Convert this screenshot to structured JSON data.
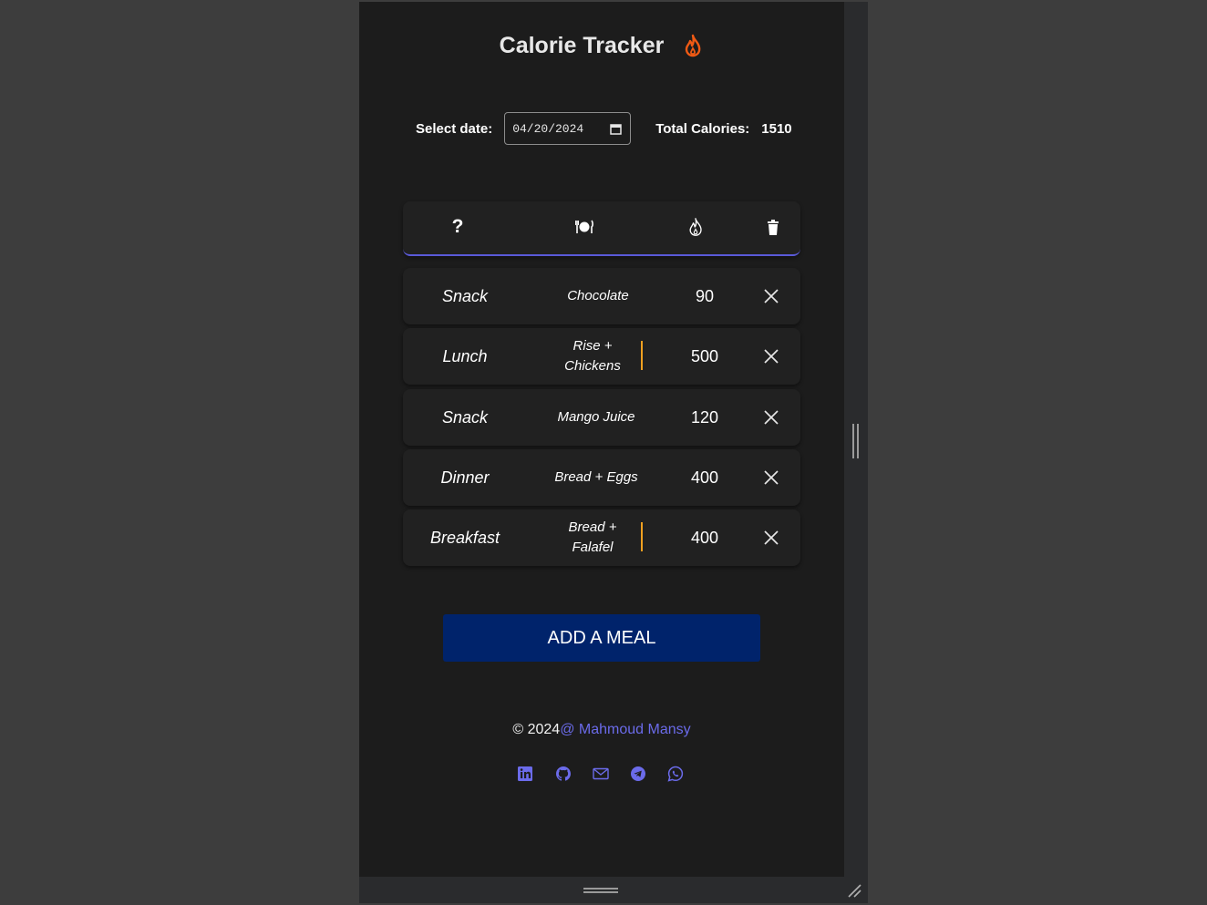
{
  "app": {
    "title": "Calorie Tracker",
    "accent": "#5a5ad8",
    "flame_color": "#f05a14"
  },
  "date_row": {
    "select_label": "Select date:",
    "date_value": "04/20/2024",
    "total_label": "Total Calories:",
    "total_value": "1510"
  },
  "table_header": {
    "icons": [
      "question-mark-icon",
      "plate-cutlery-icon",
      "flame-icon",
      "trash-icon"
    ],
    "question_glyph": "?"
  },
  "meals": [
    {
      "type": "Snack",
      "food": "Chocolate",
      "calories": "90",
      "flagged": false
    },
    {
      "type": "Lunch",
      "food": "Rise + Chickens",
      "calories": "500",
      "flagged": true
    },
    {
      "type": "Snack",
      "food": "Mango Juice",
      "calories": "120",
      "flagged": false
    },
    {
      "type": "Dinner",
      "food": "Bread + Eggs",
      "calories": "400",
      "flagged": false
    },
    {
      "type": "Breakfast",
      "food": "Bread + Falafel",
      "calories": "400",
      "flagged": true
    }
  ],
  "actions": {
    "add_meal_label": "ADD A MEAL",
    "button_color": "#00236b"
  },
  "footer": {
    "copyright": "© 2024",
    "author": "@ Mahmoud Mansy",
    "socials": [
      "linkedin-icon",
      "github-icon",
      "mail-icon",
      "telegram-icon",
      "whatsapp-icon"
    ]
  }
}
